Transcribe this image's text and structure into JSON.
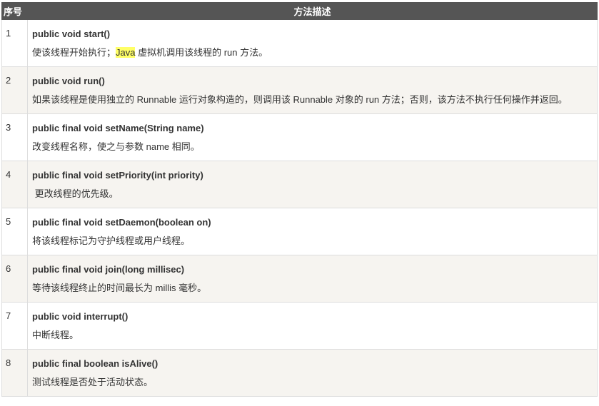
{
  "header": {
    "col_num": "序号",
    "col_desc": "方法描述"
  },
  "rows": [
    {
      "num": "1",
      "signature": "public void start()",
      "desc_before": "使该线程开始执行；",
      "desc_highlight": "Java",
      "desc_after": " 虚拟机调用该线程的 run 方法。"
    },
    {
      "num": "2",
      "signature": "public void run()",
      "desc": "如果该线程是使用独立的 Runnable 运行对象构造的，则调用该 Runnable 对象的 run 方法；否则，该方法不执行任何操作并返回。"
    },
    {
      "num": "3",
      "signature": "public final void setName(String name)",
      "desc": "改变线程名称，使之与参数 name 相同。"
    },
    {
      "num": "4",
      "signature": "public final void setPriority(int priority)",
      "desc": " 更改线程的优先级。"
    },
    {
      "num": "5",
      "signature": "public final void setDaemon(boolean on)",
      "desc": "将该线程标记为守护线程或用户线程。"
    },
    {
      "num": "6",
      "signature": "public final void join(long millisec)",
      "desc": "等待该线程终止的时间最长为 millis 毫秒。"
    },
    {
      "num": "7",
      "signature": "public void interrupt()",
      "desc": "中断线程。"
    },
    {
      "num": "8",
      "signature": "public final boolean isAlive()",
      "desc": "测试线程是否处于活动状态。"
    }
  ],
  "colors": {
    "header_bg": "#555555",
    "row_alt_bg": "#f6f4f0",
    "highlight": "#ffff66"
  }
}
